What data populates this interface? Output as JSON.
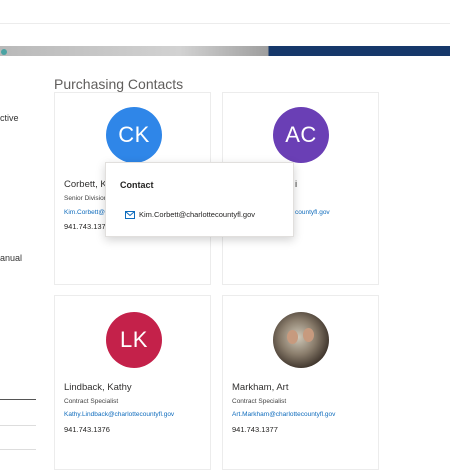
{
  "sidebar": {
    "fragments": [
      "ctive",
      "anual"
    ]
  },
  "section": {
    "heading": "Purchasing Contacts"
  },
  "contacts": [
    {
      "initials": "CK",
      "name": "Corbett, Ki",
      "title": "Senior Division",
      "email": "Kim.Corbett@",
      "phone": "941.743.137",
      "avatar_color": "#2f86e8"
    },
    {
      "initials": "AC",
      "name": "i",
      "title": "",
      "email": "tt",
      "email2": "countyfl.gov",
      "phone": "",
      "avatar_color": "#6a3fb5"
    },
    {
      "initials": "LK",
      "name": "Lindback, Kathy",
      "title": "Contract Specialist",
      "email": "Kathy.Lindback@charlottecountyfl.gov",
      "phone": "941.743.1376",
      "avatar_color": "#c4214a"
    },
    {
      "initials": "",
      "name": "Markham, Art",
      "title": "Contract Specialist",
      "email": "Art.Markham@charlottecountyfl.gov",
      "phone": "941.743.1377",
      "avatar": "photo"
    }
  ],
  "popup": {
    "title": "Contact",
    "email": "Kim.Corbett@charlottecountyfl.gov",
    "icon": "mail-icon"
  }
}
